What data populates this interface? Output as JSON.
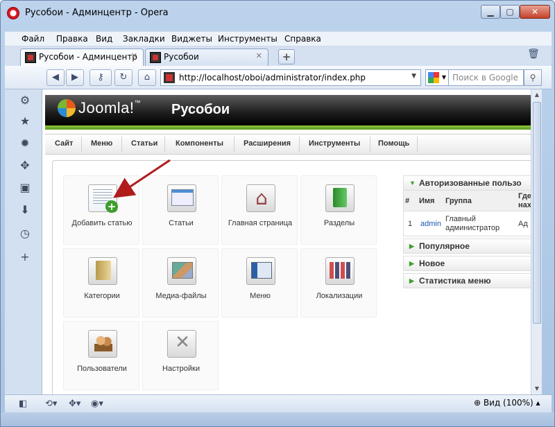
{
  "window": {
    "title": "Русобои - Админцентр - Opera"
  },
  "menubar": [
    "Файл",
    "Правка",
    "Вид",
    "Закладки",
    "Виджеты",
    "Инструменты",
    "Справка"
  ],
  "tabs": [
    {
      "label": "Русобои - Админцентр",
      "close": "✕"
    },
    {
      "label": "Русобои",
      "close": "✕"
    }
  ],
  "newtab": "+",
  "address": {
    "url": "http://localhost/oboi/administrator/index.php"
  },
  "search": {
    "placeholder": "Поиск в Google"
  },
  "joomla": {
    "logo": "Joomla!",
    "logo_tm": "™",
    "site": "Русобои",
    "menu": [
      "Сайт",
      "Меню",
      "Статьи",
      "Компоненты",
      "Расширения",
      "Инструменты",
      "Помощь"
    ],
    "icons": [
      {
        "label": "Добавить статью"
      },
      {
        "label": "Статьи"
      },
      {
        "label": "Главная страница"
      },
      {
        "label": "Разделы"
      },
      {
        "label": "Категории"
      },
      {
        "label": "Медиа-файлы"
      },
      {
        "label": "Меню"
      },
      {
        "label": "Локализации"
      },
      {
        "label": "Пользователи"
      },
      {
        "label": "Настройки"
      }
    ],
    "modules": {
      "logged": {
        "title": "Авторизованные пользо",
        "col_num": "#",
        "col_name": "Имя",
        "col_group": "Группа",
        "col_where_1": "Где",
        "col_where_2": "нах",
        "row_num": "1",
        "row_name": "admin",
        "row_group_1": "Главный",
        "row_group_2": "администратор",
        "row_where": "Ад"
      },
      "others": [
        "Популярное",
        "Новое",
        "Статистика меню"
      ]
    }
  },
  "statusbar": {
    "zoom": "Вид (100%)"
  },
  "colors": {
    "accent_green": "#8ec63f",
    "arrow_red": "#b01c1c",
    "opera_red": "#d7161e"
  }
}
